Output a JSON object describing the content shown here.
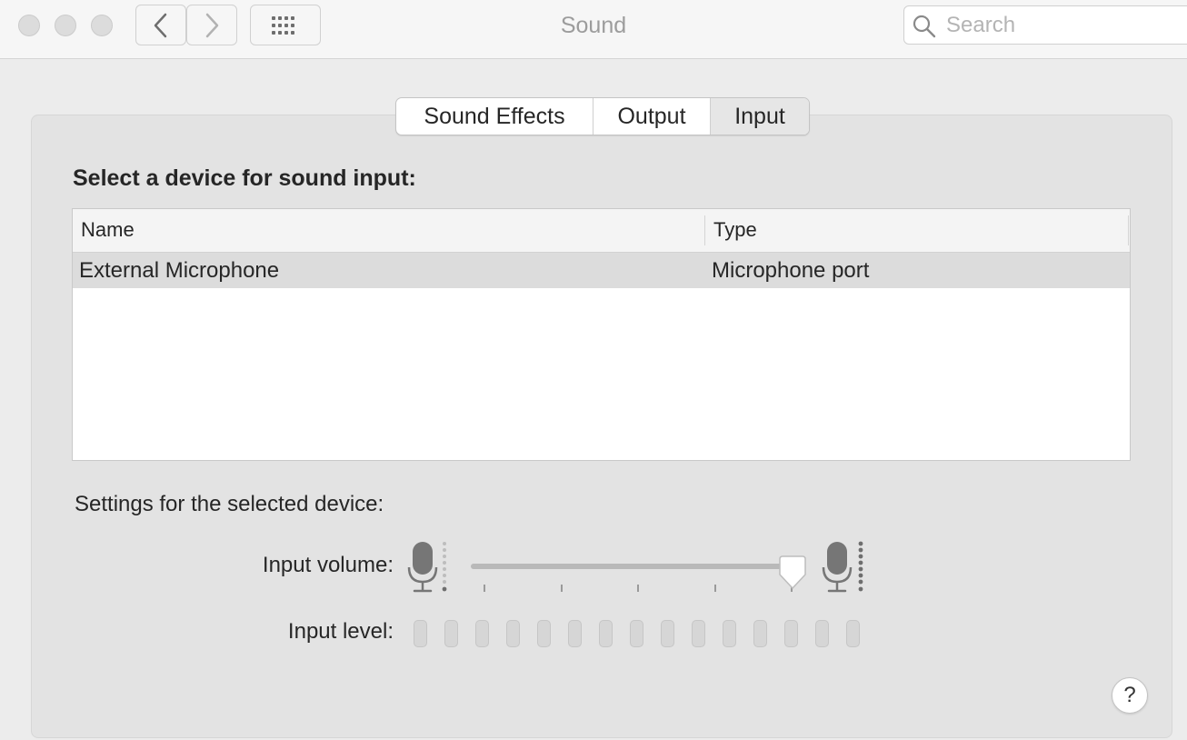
{
  "window": {
    "title": "Sound"
  },
  "toolbar": {
    "search_placeholder": "Search",
    "icons": [
      "close-icon",
      "minimize-icon",
      "zoom-icon",
      "back-icon",
      "forward-icon",
      "grid-icon",
      "search-icon"
    ]
  },
  "tabs": [
    {
      "label": "Sound Effects",
      "selected": false
    },
    {
      "label": "Output",
      "selected": false
    },
    {
      "label": "Input",
      "selected": true
    }
  ],
  "main": {
    "heading": "Select a device for sound input:",
    "table": {
      "columns": [
        "Name",
        "Type"
      ],
      "rows": [
        {
          "name": "External Microphone",
          "type": "Microphone port",
          "selected": true
        }
      ]
    },
    "settings_heading": "Settings for the selected device:",
    "input_volume": {
      "label": "Input volume:",
      "value_fraction": 0.97
    },
    "input_level": {
      "label": "Input level:",
      "segments": 15,
      "active": 0
    },
    "help_label": "?"
  }
}
